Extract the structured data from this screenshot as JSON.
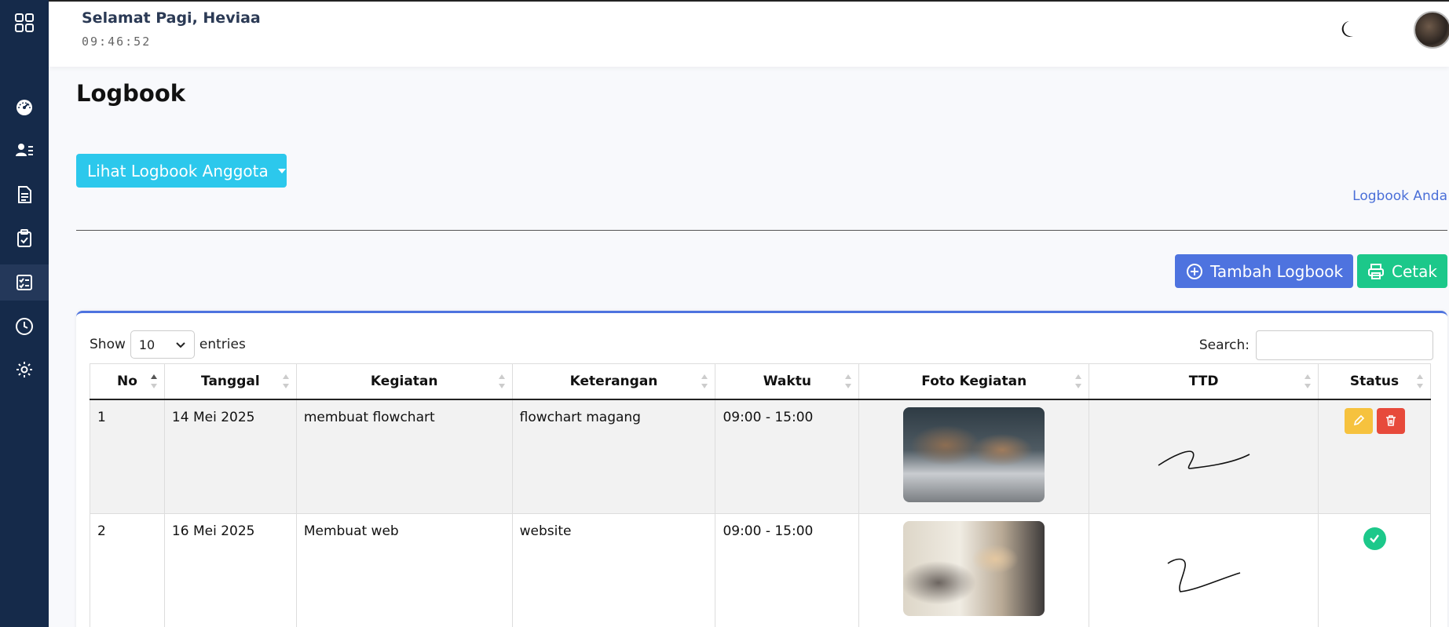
{
  "topbar": {
    "greeting": "Selamat Pagi, Heviaa",
    "clock": "09:46:52"
  },
  "page": {
    "title": "Logbook"
  },
  "actions": {
    "member_dropdown_label": "Lihat Logbook Anggota",
    "my_logbook_link": "Logbook Anda",
    "add_label": "Tambah Logbook",
    "print_label": "Cetak"
  },
  "table_controls": {
    "show_label": "Show",
    "entries_value": "10",
    "entries_label": "entries",
    "search_label": "Search:",
    "search_value": ""
  },
  "table": {
    "columns": [
      "No",
      "Tanggal",
      "Kegiatan",
      "Keterangan",
      "Waktu",
      "Foto Kegiatan",
      "TTD",
      "Status"
    ],
    "rows": [
      {
        "no": "1",
        "tanggal": "14 Mei 2025",
        "kegiatan": "membuat flowchart",
        "keterangan": "flowchart magang",
        "waktu": "09:00 - 15:00",
        "status": "actions"
      },
      {
        "no": "2",
        "tanggal": "16 Mei 2025",
        "kegiatan": "Membuat web",
        "keterangan": "website",
        "waktu": "09:00 - 15:00",
        "status": "approved"
      }
    ]
  },
  "icons": {
    "sidebar": [
      "grid-icon",
      "dashboard-icon",
      "users-icon",
      "document-icon",
      "clipboard-check-icon",
      "checklist-icon",
      "clock-icon",
      "settings-icon"
    ],
    "theme": "moon-icon"
  },
  "colors": {
    "sidebar": "#152a4a",
    "info": "#2cc8ec",
    "primary": "#4e73df",
    "success": "#1cc88a",
    "warning": "#f6c23e",
    "danger": "#e74a3b"
  }
}
